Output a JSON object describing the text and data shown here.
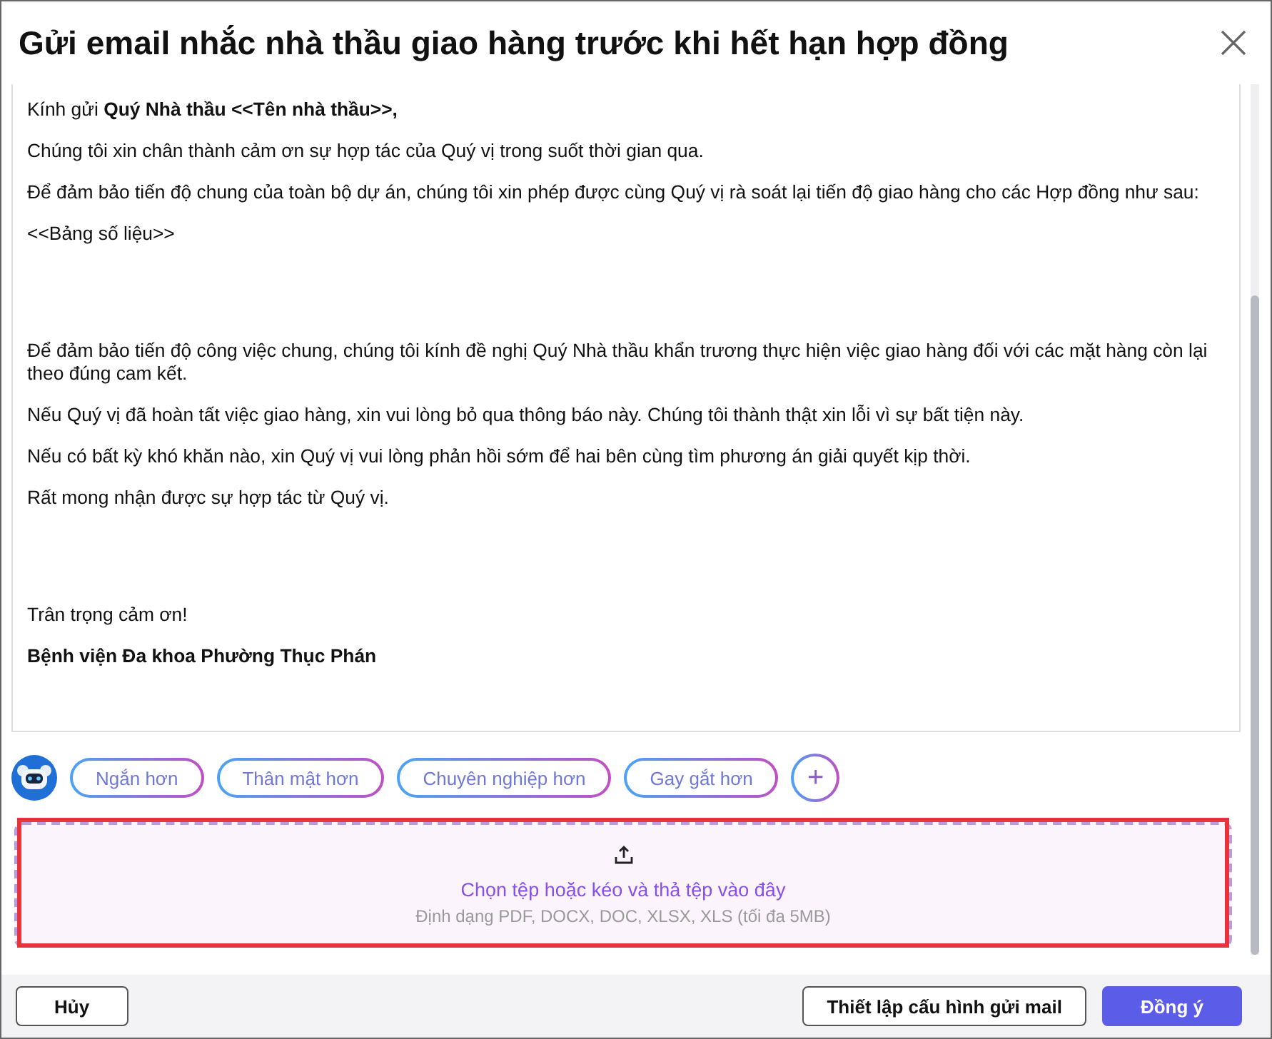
{
  "dialog": {
    "title": "Gửi email nhắc nhà thầu giao hàng trước khi hết hạn hợp đồng"
  },
  "email": {
    "paragraphs": [
      {
        "kind": "text",
        "text": "Kính gửi **Quý Nhà thầu <<Tên nhà thầu>>,**"
      },
      {
        "kind": "text",
        "text": "Chúng tôi xin chân thành cảm ơn sự hợp tác của Quý vị trong suốt thời gian qua."
      },
      {
        "kind": "text",
        "text": "Để đảm bảo tiến độ chung của toàn bộ dự án, chúng tôi xin phép được cùng Quý vị rà soát lại tiến độ giao hàng cho các Hợp đồng như sau:"
      },
      {
        "kind": "block",
        "text": "<<Bảng số liệu>>"
      },
      {
        "kind": "text",
        "text": "Để đảm bảo tiến độ công việc chung, chúng tôi kính đề nghị Quý Nhà thầu khẩn trương thực hiện việc giao hàng đối với các mặt hàng còn lại theo đúng cam kết."
      },
      {
        "kind": "text",
        "text": "Nếu Quý vị đã hoàn tất việc giao hàng, xin vui lòng bỏ qua thông báo này. Chúng tôi thành thật xin lỗi vì sự bất tiện này."
      },
      {
        "kind": "text",
        "text": "Nếu có bất kỳ khó khăn nào, xin Quý vị vui lòng phản hồi sớm để hai bên cùng tìm phương án giải quyết kịp thời."
      },
      {
        "kind": "block",
        "text": "Rất mong nhận được sự hợp tác từ Quý vị."
      },
      {
        "kind": "text",
        "text": "Trân trọng cảm ơn!"
      },
      {
        "kind": "signature",
        "text": "Bệnh viện Đa khoa Phường Thục Phán"
      }
    ]
  },
  "tone_chips": [
    "Ngắn hơn",
    "Thân mật hơn",
    "Chuyên nghiệp hơn",
    "Gay gắt hơn"
  ],
  "add_chip": "+",
  "upload": {
    "highlighted": true,
    "prompt": "Chọn tệp hoặc kéo và thả tệp vào đây",
    "hint": "Định dạng PDF, DOCX, DOC, XLSX, XLS (tối đa 5MB)"
  },
  "footer": {
    "left_buttons": [
      {
        "kind": "outline",
        "label": "Hủy"
      }
    ],
    "right_buttons": [
      {
        "kind": "outline",
        "label": "Thiết lập cấu hình gửi mail"
      },
      {
        "kind": "primary",
        "label": "Đồng ý"
      }
    ]
  }
}
